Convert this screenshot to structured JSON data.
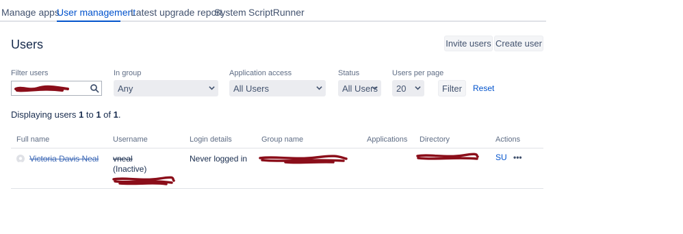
{
  "tabs": [
    {
      "label": "Manage apps"
    },
    {
      "label": "User management"
    },
    {
      "label": "Latest upgrade report"
    },
    {
      "label": "System"
    },
    {
      "label": "ScriptRunner"
    }
  ],
  "active_tab": "User management",
  "page": {
    "title": "Users"
  },
  "header_buttons": {
    "invite": "Invite users",
    "create": "Create user"
  },
  "filters": {
    "filter_users_label": "Filter users",
    "in_group_label": "In group",
    "in_group_value": "Any",
    "app_access_label": "Application access",
    "app_access_value": "All Users",
    "status_label": "Status",
    "status_value": "All Users",
    "per_page_label": "Users per page",
    "per_page_value": "20",
    "filter_button": "Filter",
    "reset_link": "Reset"
  },
  "display": {
    "prefix": "Displaying users ",
    "from": "1",
    "to_word": " to ",
    "to": "1",
    "of_word": " of ",
    "total": "1",
    "suffix": "."
  },
  "table": {
    "headers": [
      "Full name",
      "Username",
      "Login details",
      "Group name",
      "Applications",
      "Directory",
      "Actions"
    ],
    "rows": [
      {
        "full_name": "Victoria Davis Neal",
        "username": "vneal",
        "status": "(Inactive)",
        "login_details": "Never logged in",
        "action_su": "SU",
        "action_more": "•••"
      }
    ]
  },
  "colors": {
    "accent": "#0052cc",
    "redaction": "#8b0e1a"
  }
}
